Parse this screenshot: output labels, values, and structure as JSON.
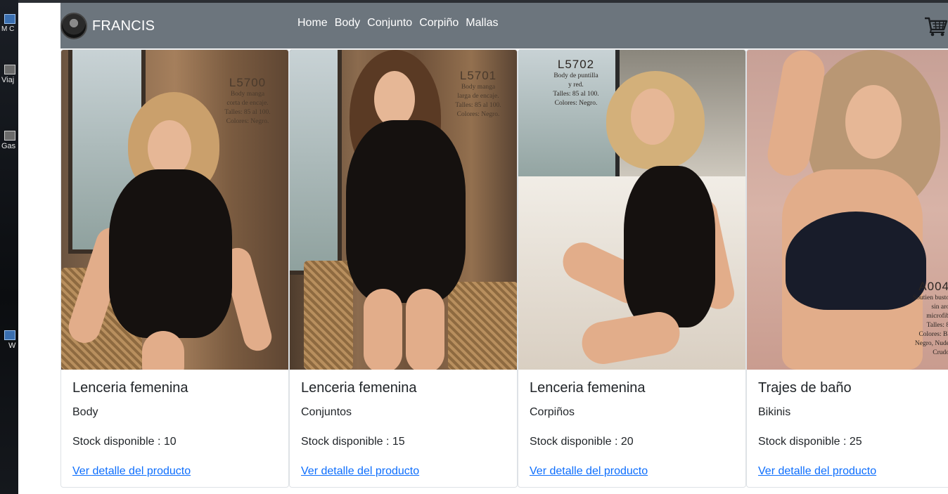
{
  "desktop": {
    "icons": [
      {
        "label": "M\nC",
        "icon": "folder-icon"
      },
      {
        "label": "Viaj",
        "icon": "shortcut-icon"
      },
      {
        "label": "Gas",
        "icon": "shortcut-icon"
      },
      {
        "label": "W",
        "icon": "shortcut-icon"
      }
    ]
  },
  "navbar": {
    "brand": "FRANCIS",
    "links": [
      "Home",
      "Body",
      "Conjunto",
      "Corpiño",
      "Mallas"
    ],
    "cart_icon": "cart-icon",
    "background": "#6c757d"
  },
  "products": [
    {
      "title": "Lenceria femenina",
      "subtitle": "Body",
      "stock": "Stock disponible : 10",
      "link": "Ver detalle del producto",
      "catalog_code": "L5700",
      "catalog_text": [
        "Body manga",
        "corta de encaje.",
        "Talles: 85 al 100.",
        "Colores: Negro."
      ]
    },
    {
      "title": "Lenceria femenina",
      "subtitle": "Conjuntos",
      "stock": "Stock disponible : 15",
      "link": "Ver detalle del producto",
      "catalog_code": "L5701",
      "catalog_text": [
        "Body manga",
        "larga de encaje.",
        "Talles: 85 al 100.",
        "Colores: Negro."
      ]
    },
    {
      "title": "Lenceria femenina",
      "subtitle": "Corpiños",
      "stock": "Stock disponible : 20",
      "link": "Ver detalle del producto",
      "catalog_code": "L5702",
      "catalog_text": [
        "Body de puntilla",
        "y red.",
        "Talles: 85 al 100.",
        "Colores: Negro."
      ]
    },
    {
      "title": "Trajes de baño",
      "subtitle": "Bikinis",
      "stock": "Stock disponible : 25",
      "link": "Ver detalle del producto",
      "catalog_code": "A004",
      "catalog_text": [
        "Soutien busto",
        "sin aro",
        "microfib",
        "Talles: 8",
        "Colores: Bl",
        "Negro, Nude",
        "Crudo"
      ]
    }
  ],
  "colors": {
    "link": "#0d6efd",
    "text": "#212529",
    "card_border": "#dee2e6"
  }
}
